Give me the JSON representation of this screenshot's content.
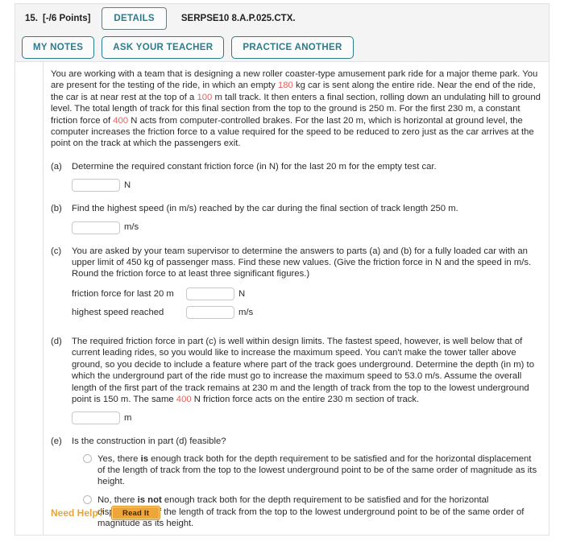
{
  "header": {
    "question_number": "15.",
    "points": "[-/6 Points]",
    "details_label": "DETAILS",
    "problem_code": "SERPSE10 8.A.P.025.CTX.",
    "buttons": [
      {
        "label": "MY NOTES",
        "name": "my-notes-button"
      },
      {
        "label": "ASK YOUR TEACHER",
        "name": "ask-your-teacher-button"
      },
      {
        "label": "PRACTICE ANOTHER",
        "name": "practice-another-button"
      }
    ]
  },
  "intro": {
    "seg1": "You are working with a team that is designing a new roller coaster-type amusement park ride for a major theme park. You are present for the testing of the ride, in which an empty ",
    "val_mass": "180",
    "seg2": " kg car is sent along the entire ride. Near the end of the ride, the car is at near rest at the top of a ",
    "val_height": "100",
    "seg3": " m tall track. It then enters a final section, rolling down an undulating hill to ground level. The total length of track for this final section from the top to the ground is 250 m. For the first 230 m, a constant friction force of ",
    "val_friction": "400",
    "seg4": " N acts from computer-controlled brakes. For the last 20 m, which is horizontal at ground level, the computer increases the friction force to a value required for the speed to be reduced to zero just as the car arrives at the point on the track at which the passengers exit."
  },
  "parts": {
    "a": {
      "label": "(a)",
      "text": "Determine the required constant friction force (in N) for the last 20 m for the empty test car.",
      "input_value": "",
      "unit": "N"
    },
    "b": {
      "label": "(b)",
      "text": "Find the highest speed (in m/s) reached by the car during the final section of track length 250 m.",
      "input_value": "",
      "unit": "m/s"
    },
    "c": {
      "label": "(c)",
      "text": "You are asked by your team supervisor to determine the answers to parts (a) and (b) for a fully loaded car with an upper limit of 450 kg of passenger mass. Find these new values. (Give the friction force in N and the speed in m/s. Round the friction force to at least three significant figures.)",
      "fields": [
        {
          "label": "friction force for last 20 m",
          "input_value": "",
          "unit": "N",
          "name": "friction-force-input"
        },
        {
          "label": "highest speed reached",
          "input_value": "",
          "unit": "m/s",
          "name": "highest-speed-input"
        }
      ]
    },
    "d": {
      "label": "(d)",
      "seg1": "The required friction force in part (c) is well within design limits. The fastest speed, however, is well below that of current leading rides, so you would like to increase the maximum speed. You can't make the tower taller above ground, so you decide to include a feature where part of the track goes underground. Determine the depth (in m) to which the underground part of the ride must go to increase the maximum speed to 53.0 m/s. Assume the overall length of the first part of the track remains at 230 m and the length of track from the top to the lowest underground point is 150 m. The same ",
      "val_friction": "400",
      "seg2": " N friction force acts on the entire 230 m section of track.",
      "input_value": "",
      "unit": "m"
    },
    "e": {
      "label": "(e)",
      "text": "Is the construction in part (d) feasible?",
      "options": [
        {
          "pre": "Yes, there ",
          "bold": "is",
          "post": " enough track both for the depth requirement to be satisfied and for the horizontal displacement of the length of track from the top to the lowest underground point to be of the same order of magnitude as its height.",
          "name": "radio-option-yes",
          "selected": false
        },
        {
          "pre": "No, there ",
          "bold": "is not",
          "post": " enough track both for the depth requirement to be satisfied and for the horizontal displacement of the length of track from the top to the lowest underground point to be of the same order of magnitude as its height.",
          "name": "radio-option-no",
          "selected": false
        }
      ]
    }
  },
  "footer": {
    "need_help_label": "Need Help?",
    "read_it_label": "Read It"
  },
  "colors": {
    "teal": "#2c7c8c",
    "highlight_red": "#e0625f",
    "orange": "#e8a33d",
    "panel_bg": "#f4f4f4",
    "border": "#e2e2e2"
  }
}
